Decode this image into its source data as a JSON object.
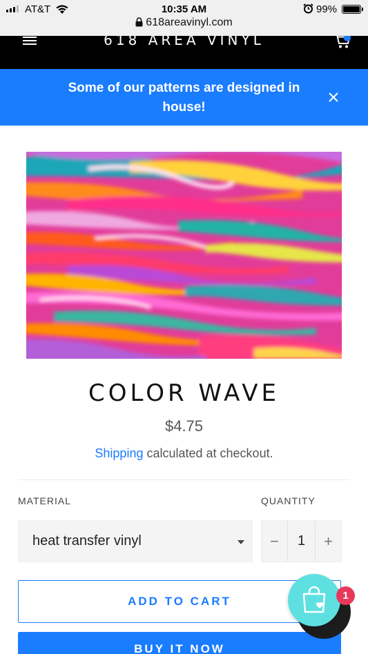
{
  "status_bar": {
    "carrier": "AT&T",
    "time": "10:35 AM",
    "battery": "99%",
    "url": "618areavinyl.com"
  },
  "header": {
    "brand": "618 AREA VINYL"
  },
  "announcement": {
    "text": "Some of our patterns are designed in house!"
  },
  "product": {
    "title": "COLOR WAVE",
    "price": "$4.75",
    "shipping_link": "Shipping",
    "shipping_text": " calculated at checkout.",
    "material_label": "MATERIAL",
    "material_value": "heat transfer vinyl",
    "quantity_label": "QUANTITY",
    "quantity_minus": "−",
    "quantity_value": "1",
    "quantity_plus": "+",
    "add_to_cart": "ADD TO CART",
    "buy_now": "BUY IT NOW"
  },
  "widgets": {
    "wishlist_count": "1"
  },
  "colors": {
    "accent": "#1a7cff",
    "header_bg": "#000000",
    "wishlist": "#5ee0e0",
    "badge": "#e8395a"
  },
  "icons": [
    "signal-icon",
    "wifi-icon",
    "alarm-icon",
    "battery-icon",
    "lock-icon",
    "menu-icon",
    "cart-icon",
    "close-icon",
    "chevron-down-icon",
    "shopping-bag-heart-icon",
    "chat-icon"
  ]
}
